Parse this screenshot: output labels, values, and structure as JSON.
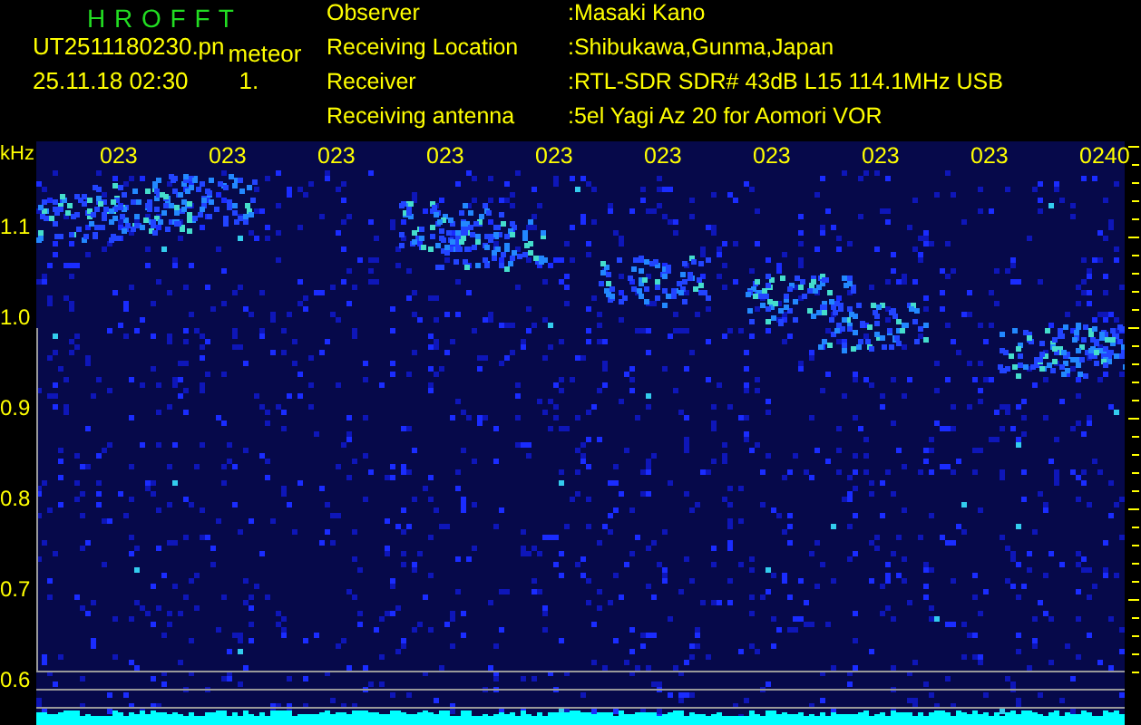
{
  "app": {
    "title": "H R O F F T",
    "filename": "UT2511180230.pn",
    "mode": "meteor",
    "timestamp": "25.11.18 02:30",
    "count": "1."
  },
  "station": [
    {
      "label": "Observer",
      "value": ":Masaki Kano"
    },
    {
      "label": "Receiving Location",
      "value": ":Shibukawa,Gunma,Japan"
    },
    {
      "label": "Receiver",
      "value": ":RTL-SDR SDR# 43dB L15 114.1MHz USB"
    },
    {
      "label": "Receiving antenna",
      "value": ":5el Yagi Az 20 for Aomori VOR"
    }
  ],
  "y_axis": {
    "unit": "kHz",
    "labels": [
      "1.1",
      "1.0",
      "0.9",
      "0.8",
      "0.7",
      "0.6"
    ]
  },
  "time_labels": [
    "023",
    "023",
    "023",
    "023",
    "023",
    "023",
    "023",
    "023",
    "023",
    "0240"
  ]
}
